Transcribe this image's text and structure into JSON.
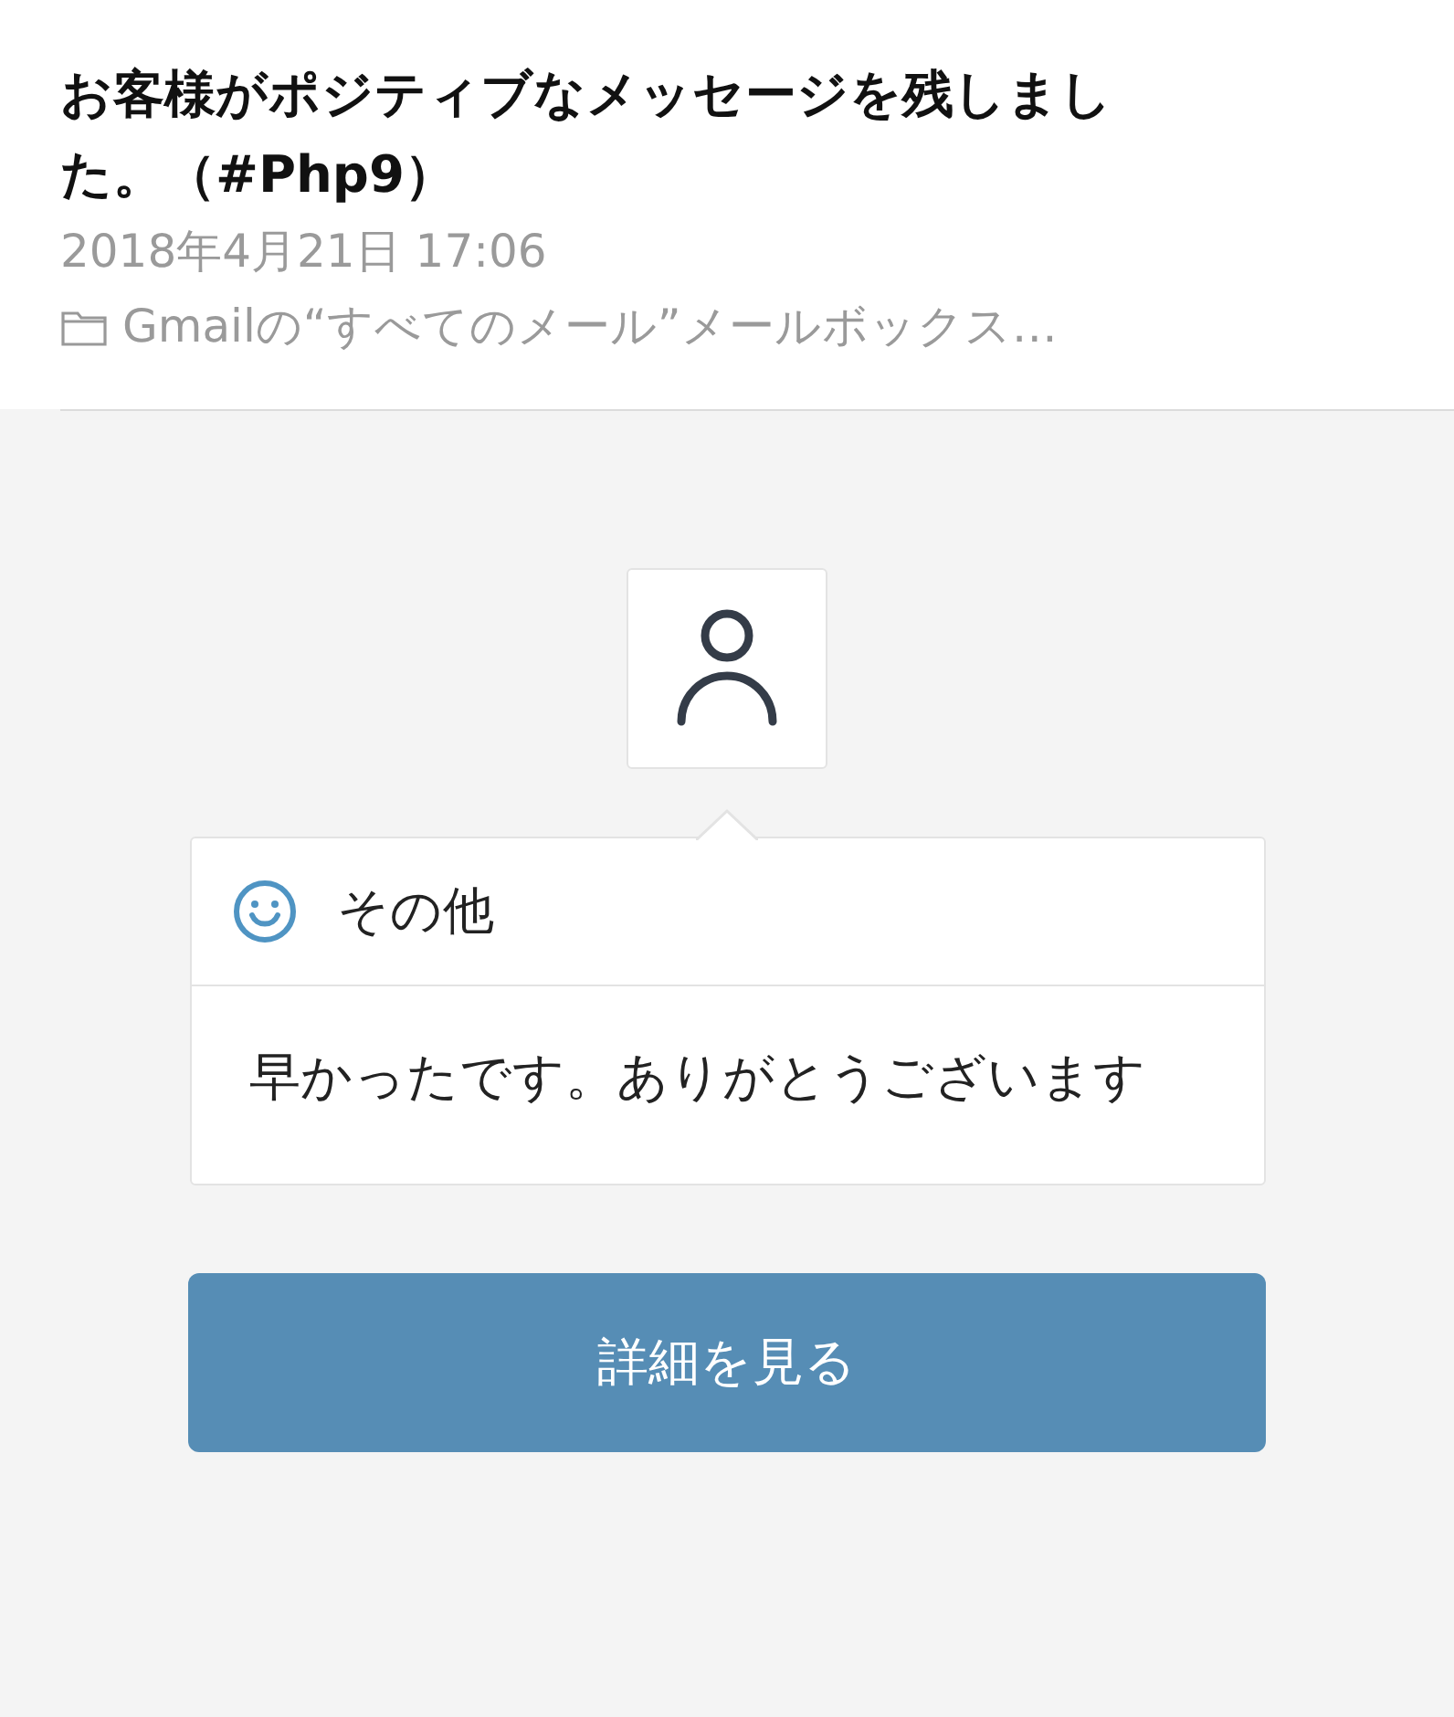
{
  "message_header": {
    "title": "お客様がポジティブなメッセージを残しました。（#Php9）",
    "date": "2018年4月21日 17:06",
    "mailbox": "Gmailの“すべてのメール”メールボックス…"
  },
  "feedback": {
    "category": "その他",
    "message": "早かったです。ありがとうございます"
  },
  "button": {
    "label": "詳細を見る"
  }
}
